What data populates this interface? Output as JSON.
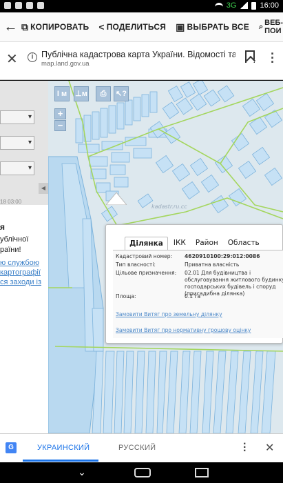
{
  "status_bar": {
    "network": "3G",
    "time": "16:00"
  },
  "cab": {
    "copy_label": "КОПИРОВАТЬ",
    "share_label": "ПОДЕЛИТЬСЯ",
    "select_all_label": "ВЫБРАТЬ ВСЕ",
    "web_search_line1": "ВЕБ-",
    "web_search_line2": "ПОИ"
  },
  "address_bar": {
    "title": "Публічна кадастрова карта України. Відомості та...",
    "url": "map.land.gov.ua"
  },
  "left_panel": {
    "date": "18 03:00",
    "heading": "я",
    "text_lines": [
      "ублічної",
      "раїни!"
    ],
    "link_lines": [
      "ю службою",
      "картографії",
      "ся заходи із"
    ]
  },
  "map_tools": {
    "tool1": "I м",
    "tool2": "⊥м",
    "zoom_in": "+",
    "zoom_out": "−",
    "watermark": "kadastr.ru.cc"
  },
  "popup": {
    "tabs": [
      "Ділянка",
      "ІКК",
      "Район",
      "Область"
    ],
    "rows": [
      {
        "key": "Кадастровий номер:",
        "value": "4620910100:29:012:0086"
      },
      {
        "key": "Тип власності:",
        "value": "Приватна власність"
      },
      {
        "key": "Цільове призначення:",
        "value": "02.01 Для будівництва і обслуговування житлового будинку, господарських будівель і споруд (присадибна ділянка)"
      },
      {
        "key": "Площа:",
        "value": "0.1 га"
      }
    ],
    "link1": "Замовити Витяг про земельну ділянку",
    "link2": "Замовити Витяг про нормативну грошову оцінку"
  },
  "translate_bar": {
    "lang_selected": "УКРАИНСКИЙ",
    "lang_other": "РУССКИЙ"
  },
  "colors": {
    "link_blue": "#4a87c8",
    "translate_blue": "#1a73e8",
    "parcel_fill": "#b9d9f0",
    "parcel_stroke": "#7db3dc",
    "road_green": "#a4d65e"
  }
}
